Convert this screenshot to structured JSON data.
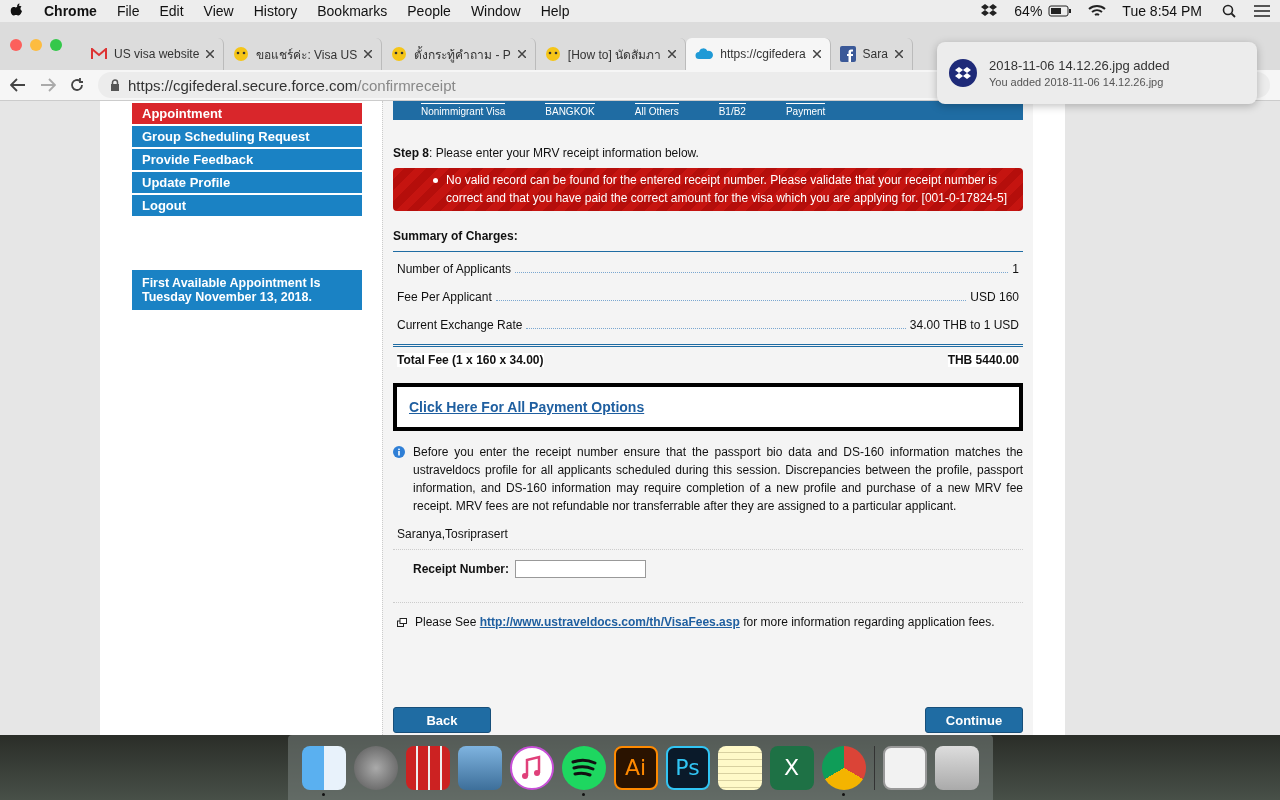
{
  "menu_bar": {
    "app": "Chrome",
    "items": [
      "File",
      "Edit",
      "View",
      "History",
      "Bookmarks",
      "People",
      "Window",
      "Help"
    ],
    "battery": "64%",
    "clock": "Tue 8:54 PM"
  },
  "tabs": [
    {
      "label": "US visa website",
      "kind": "gmail",
      "selected": false
    },
    {
      "label": "ขอแชร์ค่ะ: Visa US",
      "kind": "emoji",
      "selected": false
    },
    {
      "label": "ตั้งกระทู้คำถาม - P",
      "kind": "emoji",
      "selected": false
    },
    {
      "label": "[How to] นัดสัมภา",
      "kind": "emoji",
      "selected": false
    },
    {
      "label": "https://cgifedera",
      "kind": "cloud",
      "selected": true
    },
    {
      "label": "Sara",
      "kind": "facebook",
      "selected": false
    }
  ],
  "address": {
    "host": "https://cgifederal.secure.force.com",
    "path": "/confirmreceipt"
  },
  "notification": {
    "title": "2018-11-06 14.12.26.jpg added",
    "body": "You added 2018-11-06 14.12.26.jpg"
  },
  "sidebar": {
    "items": [
      {
        "label": "Appointment",
        "selected": true
      },
      {
        "label": "Group Scheduling Request",
        "selected": false
      },
      {
        "label": "Provide Feedback",
        "selected": false
      },
      {
        "label": "Update Profile",
        "selected": false
      },
      {
        "label": "Logout",
        "selected": false
      }
    ],
    "notice": "First Available Appointment Is Tuesday November 13, 2018."
  },
  "steps": [
    "Nonimmigrant Visa",
    "BANGKOK",
    "All Others",
    "B1/B2",
    "Payment"
  ],
  "step_label": "Step 8",
  "step_text": ": Please enter your MRV receipt information below.",
  "error": "No valid record can be found for the entered receipt number. Please validate that your receipt number is correct and that you have paid the correct amount for the visa which you are applying for. [001-0-17824-5]",
  "summary": {
    "title": "Summary of Charges:",
    "rows": [
      {
        "label": "Number of Applicants",
        "value": "1"
      },
      {
        "label": "Fee Per Applicant",
        "value": "USD 160"
      },
      {
        "label": "Current Exchange Rate",
        "value": "34.00 THB to 1 USD"
      }
    ],
    "total_label": "Total Fee (1 x 160 x 34.00)",
    "total_value": "THB 5440.00"
  },
  "payment_link": "Click Here For All Payment Options",
  "info": "Before you enter the receipt number ensure that the passport bio data and DS-160 information matches the ustraveldocs profile for all applicants scheduled during this session. Discrepancies between the profile, passport information, and DS-160 information may require completion of a new profile and purchase of a new MRV fee receipt. MRV fees are not refundable nor transferrable after they are assigned to a particular applicant.",
  "applicant": "Saranya,Tosriprasert",
  "receipt_label": "Receipt Number:",
  "fees_note": {
    "before": "Please See ",
    "link": "http://www.ustraveldocs.com/th/VisaFees.asp",
    "after": " for more information regarding application fees."
  },
  "buttons": {
    "back": "Back",
    "continue": "Continue"
  },
  "dock": [
    {
      "kind": "finder",
      "running": true
    },
    {
      "kind": "launchpad",
      "running": false
    },
    {
      "kind": "photobooth",
      "running": false
    },
    {
      "kind": "preview",
      "running": false
    },
    {
      "kind": "music",
      "running": false
    },
    {
      "kind": "spotify",
      "running": true
    },
    {
      "kind": "illustrator",
      "running": false
    },
    {
      "kind": "photoshop",
      "running": false
    },
    {
      "kind": "notes",
      "running": false
    },
    {
      "kind": "excel",
      "running": false
    },
    {
      "kind": "chrome",
      "running": true
    },
    {
      "kind": "divider"
    },
    {
      "kind": "document",
      "running": false
    },
    {
      "kind": "trash",
      "running": false
    }
  ],
  "dock_labels": {
    "illustrator": "Ai",
    "photoshop": "Ps",
    "excel": "X"
  }
}
